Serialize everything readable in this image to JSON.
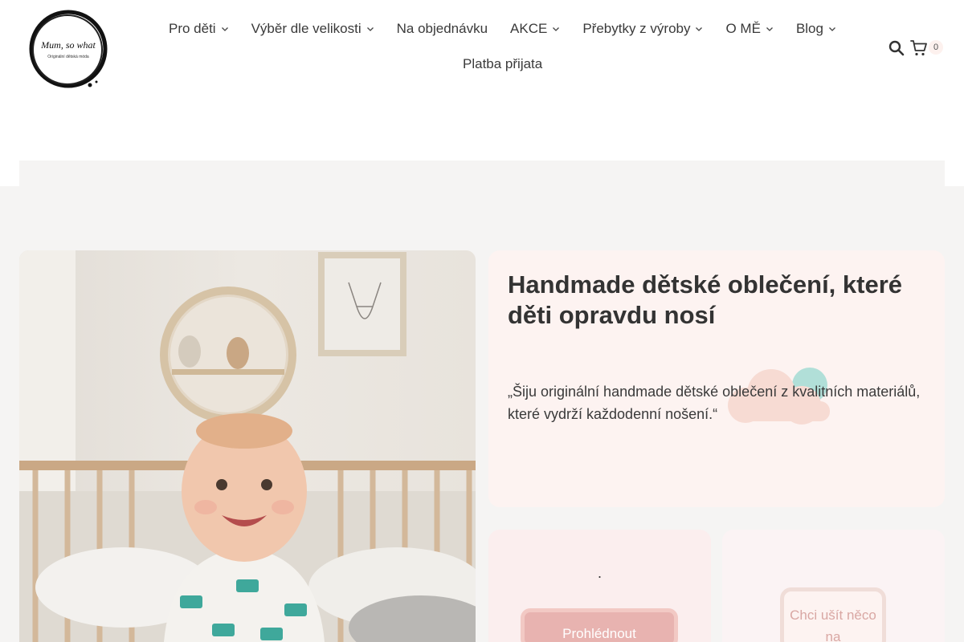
{
  "brand": {
    "logo_text": "Mum, so what",
    "logo_sub": "Originální dětská móda"
  },
  "nav": {
    "items": [
      {
        "label": "Pro děti",
        "dropdown": true
      },
      {
        "label": "Výběr dle velikosti",
        "dropdown": true
      },
      {
        "label": "Na objednávku",
        "dropdown": false
      },
      {
        "label": "AKCE",
        "dropdown": true
      },
      {
        "label": "Přebytky z výroby",
        "dropdown": true
      },
      {
        "label": "O MĚ",
        "dropdown": true
      },
      {
        "label": "Blog",
        "dropdown": true
      }
    ],
    "second_row": "Platba přijata"
  },
  "cart": {
    "count": "0"
  },
  "hero": {
    "title": "Handmade dětské oblečení, které děti opravdu nosí",
    "quote": "„Šiju originální handmade dětské oblečení z kvalitních materiálů, které vydrží každodenní nošení.“"
  },
  "cta_left": {
    "dot": ".",
    "button_label": "Prohlédnout"
  },
  "cta_right": {
    "button_label": "Chci ušít něco na"
  },
  "colors": {
    "accent_pink": "#e8b3b0",
    "card_pink": "#fdf3f1",
    "band_grey": "#f5f4f3"
  }
}
